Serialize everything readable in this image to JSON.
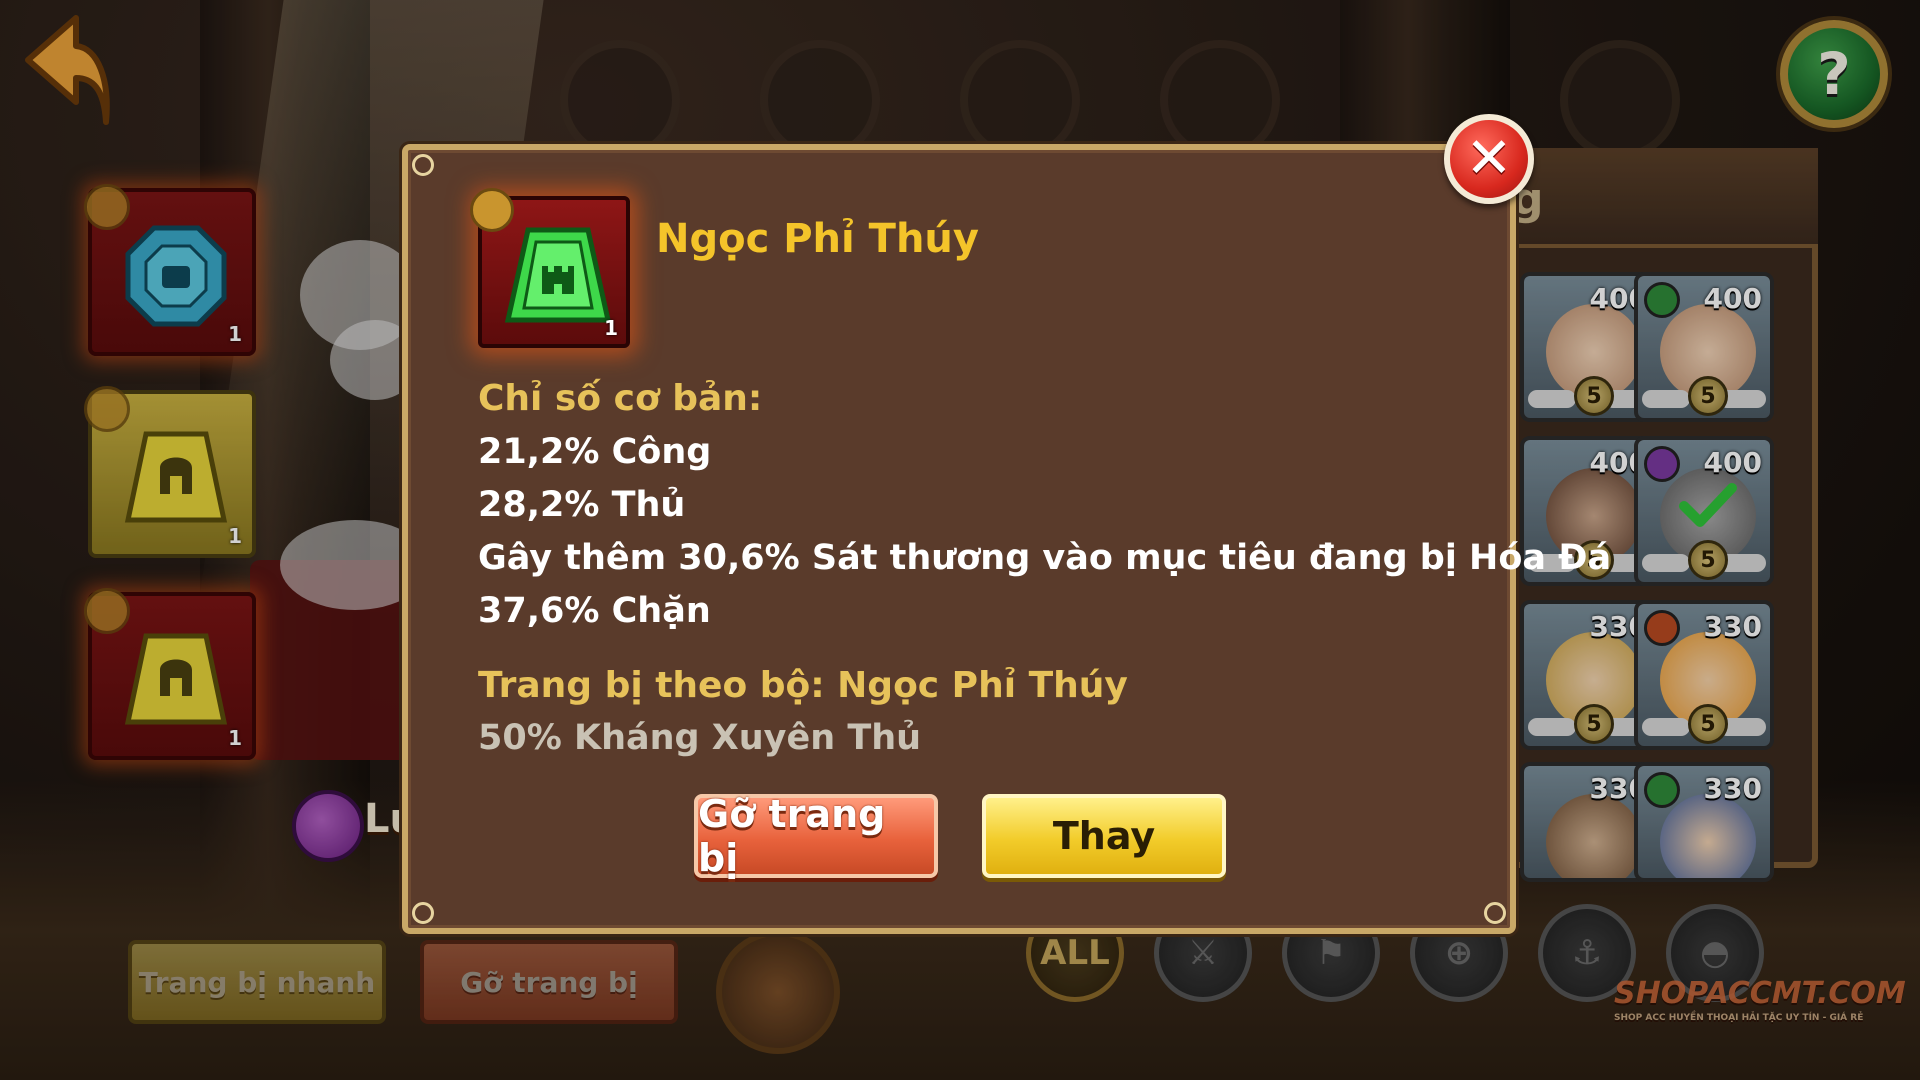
{
  "top": {
    "back_icon": "back-arrow-icon",
    "help_label": "?"
  },
  "left_slots": [
    {
      "gem": "blue-octagon-gem",
      "qty": "1",
      "frame": "red"
    },
    {
      "gem": "yellow-helmet-gem",
      "qty": "1",
      "frame": "gold"
    },
    {
      "gem": "yellow-helmet-gem",
      "qty": "1",
      "frame": "red"
    }
  ],
  "hero": {
    "name": "Lu"
  },
  "bottom_buttons": {
    "quick_equip": "Trang bị nhanh",
    "unequip": "Gỡ trang bị"
  },
  "char_panel": {
    "title_fragment": "g",
    "cards": [
      {
        "power": "400",
        "stars": "5"
      },
      {
        "power": "400",
        "stars": "5"
      },
      {
        "power": "400",
        "stars": "5"
      },
      {
        "power": "400",
        "stars": "5"
      },
      {
        "power": "330",
        "stars": "5"
      },
      {
        "power": "330",
        "stars": "5"
      },
      {
        "power": "330",
        "stars": ""
      },
      {
        "power": "330",
        "stars": ""
      }
    ],
    "filters": [
      "ALL",
      "sword-icon",
      "flag-icon",
      "crosshair-icon",
      "anchor-icon",
      "helmet-icon"
    ]
  },
  "modal": {
    "item": {
      "name": "Ngọc Phỉ Thúy",
      "qty": "1",
      "gem": "green-castle-gem"
    },
    "base_stats_title": "Chỉ số cơ bản:",
    "stats": [
      "21,2% Công",
      "28,2% Thủ",
      "Gây thêm 30,6% Sát thương vào mục tiêu đang bị Hóa Đá",
      "37,6% Chặn"
    ],
    "set_title": "Trang bị theo bộ: Ngọc Phỉ Thúy",
    "set_bonus": "50% Kháng Xuyên Thủ",
    "buttons": {
      "unequip": "Gỡ trang bị",
      "replace": "Thay"
    },
    "close_label": "✕"
  },
  "watermark": {
    "text": "SHOPACCMT.COM",
    "sub": "SHOP ACC HUYỀN THOẠI HẢI TẶC UY TÍN - GIÁ RẺ"
  },
  "colors": {
    "modal_bg": "#5a3b2b",
    "modal_border": "#c9a867",
    "item_name": "#f4c42a",
    "section_title": "#e7c25a",
    "close_red": "#d8281e",
    "unequip_orange": "#e8623c",
    "replace_yellow": "#f2cc2a"
  }
}
